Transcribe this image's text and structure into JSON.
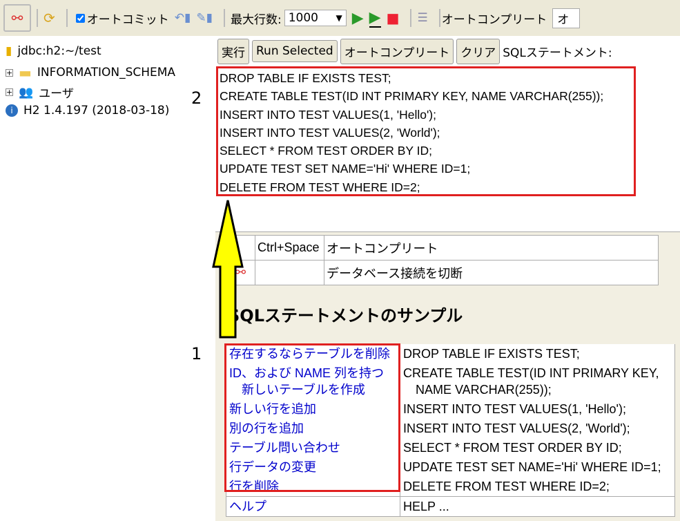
{
  "toolbar": {
    "autocommit_label": "オートコミット",
    "autocommit_checked": true,
    "max_rows_label": "最大行数:",
    "max_rows_value": "1000",
    "autocomplete_label": "オートコンプリート",
    "autocomplete_value": "オ"
  },
  "tree": {
    "connection": "jdbc:h2:~/test",
    "schema": "INFORMATION_SCHEMA",
    "users": "ユーザ",
    "version": "H2 1.4.197 (2018-03-18)"
  },
  "buttons": {
    "run": "実行",
    "run_selected": "Run Selected",
    "autocomplete": "オートコンプリート",
    "clear": "クリア",
    "sql_label": "SQLステートメント:"
  },
  "sql_lines": [
    "DROP TABLE IF EXISTS TEST;",
    "CREATE TABLE TEST(ID INT PRIMARY KEY, NAME VARCHAR(255));",
    "INSERT INTO TEST VALUES(1, 'Hello');",
    "INSERT INTO TEST VALUES(2, 'World');",
    "SELECT * FROM TEST ORDER BY ID;",
    "UPDATE TEST SET NAME='Hi' WHERE ID=1;",
    "DELETE FROM TEST WHERE ID=2;"
  ],
  "help_rows": [
    {
      "key": "Ctrl+Space",
      "desc": "オートコンプリート"
    },
    {
      "key": "",
      "desc": "データベース接続を切断"
    }
  ],
  "sample_heading": "SQLステートメントのサンプル",
  "samples": [
    {
      "link": "存在するならテーブルを削除",
      "sql": "DROP TABLE IF EXISTS TEST;"
    },
    {
      "link": "ID、および NAME 列を持つ\n　新しいテーブルを作成",
      "sql": "CREATE TABLE TEST(ID INT PRIMARY KEY,\n　NAME VARCHAR(255));"
    },
    {
      "link": "新しい行を追加",
      "sql": "INSERT INTO TEST VALUES(1, 'Hello');"
    },
    {
      "link": "別の行を追加",
      "sql": "INSERT INTO TEST VALUES(2, 'World');"
    },
    {
      "link": "テーブル問い合わせ",
      "sql": "SELECT * FROM TEST ORDER BY ID;"
    },
    {
      "link": "行データの変更",
      "sql": "UPDATE TEST SET NAME='Hi' WHERE ID=1;"
    },
    {
      "link": "行を削除",
      "sql": "DELETE FROM TEST WHERE ID=2;"
    }
  ],
  "help_link": {
    "link": "ヘルプ",
    "sql": "HELP ..."
  },
  "annotations": {
    "label1": "1",
    "label2": "2"
  },
  "colors": {
    "highlight_box": "#e02020",
    "arrow": "#ffff00",
    "link": "#0000cc"
  }
}
